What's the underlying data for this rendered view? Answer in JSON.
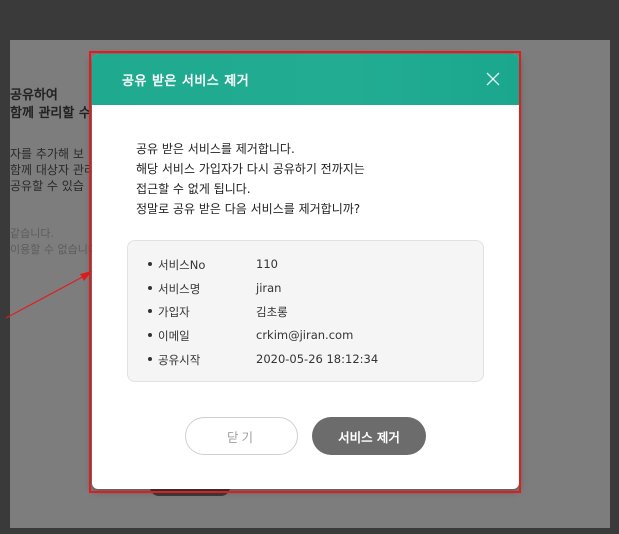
{
  "background": {
    "heading_line1": "공유하여",
    "heading_line2": "함께 관리할 수",
    "desc_line1": "자를 추가해 보",
    "desc_line2": "함께 대상자 관리",
    "desc_line3": "공유할 수 있습",
    "note_line1": "같습니다.",
    "note_line2": "이용할 수 없습니다"
  },
  "modal": {
    "title": "공유 받은 서비스 제거",
    "message": [
      "공유 받은 서비스를 제거합니다.",
      "해당 서비스 가입자가 다시 공유하기 전까지는",
      "접근할 수 없게 됩니다.",
      "정말로 공유 받은 다음 서비스를 제거합니까?"
    ],
    "info": [
      {
        "label": "서비스No",
        "value": "110"
      },
      {
        "label": "서비스명",
        "value": "jiran"
      },
      {
        "label": "가입자",
        "value": "김초롱"
      },
      {
        "label": "이메일",
        "value": "crkim@jiran.com"
      },
      {
        "label": "공유시작",
        "value": "2020-05-26 18:12:34"
      }
    ],
    "close_label": "닫기",
    "remove_label": "서비스 제거"
  },
  "colors": {
    "header": "#1fa98f",
    "highlight": "#e21c1c",
    "remove_button": "#6c6c6c"
  }
}
